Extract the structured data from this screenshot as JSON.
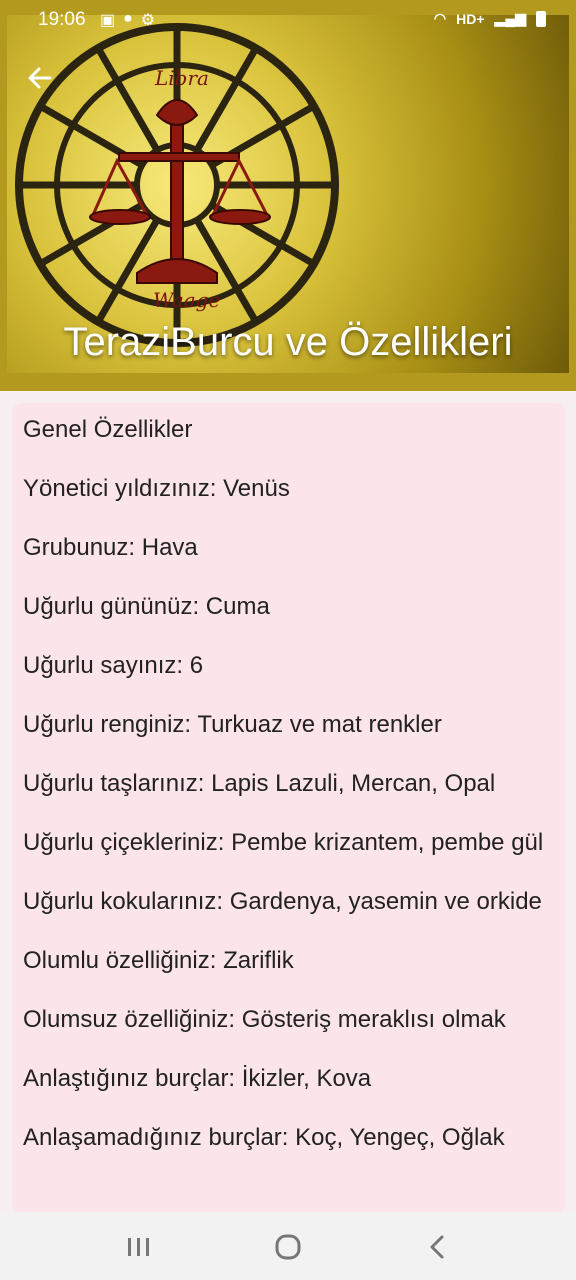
{
  "status": {
    "time": "19:06",
    "network": "HD+"
  },
  "header": {
    "title": "TeraziBurcu ve Özellikleri",
    "back_icon": "arrow-left-icon",
    "image_text_top": "Libra",
    "image_text_bottom": "Waage"
  },
  "content": {
    "lines": [
      "Genel Özellikler",
      "Yönetici yıldızınız: Venüs",
      "Grubunuz: Hava",
      "Uğurlu gününüz: Cuma",
      "Uğurlu sayınız: 6",
      "Uğurlu renginiz: Turkuaz ve mat renkler",
      "Uğurlu taşlarınız: Lapis Lazuli, Mercan, Opal",
      "Uğurlu çiçekleriniz: Pembe krizantem, pembe gül",
      "Uğurlu kokularınız: Gardenya, yasemin ve orkide",
      "Olumlu özelliğiniz: Zariflik",
      "Olumsuz özelliğiniz: Gösteriş meraklısı olmak",
      "Anlaştığınız burçlar: İkizler, Kova",
      "Anlaşamadığınız burçlar: Koç, Yengeç, Oğlak"
    ]
  },
  "nav": {
    "recent_icon": "recent-apps-icon",
    "home_icon": "home-circle-icon",
    "back_icon": "chevron-left-icon"
  },
  "colors": {
    "header_bg": "#b39a1f",
    "card_bg": "#fbe4ea",
    "text": "#222222"
  }
}
